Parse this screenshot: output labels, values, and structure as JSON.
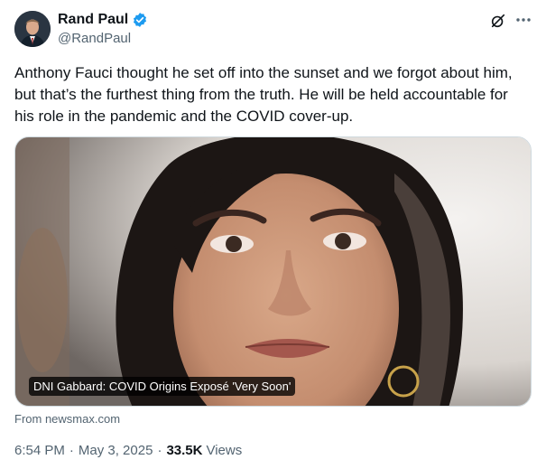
{
  "author": {
    "display_name": "Rand Paul",
    "handle": "@RandPaul",
    "verified": true
  },
  "tweet": {
    "text": "Anthony Fauci thought he set off into the sunset and we forgot about him, but that’s the furthest thing from the truth. He will be held accountable for his role in the pandemic and the COVID cover-up."
  },
  "media": {
    "caption": "DNI Gabbard: COVID Origins Exposé 'Very Soon'",
    "source": "From newsmax.com"
  },
  "meta": {
    "time": "6:54 PM",
    "separator": "·",
    "date": "May 3, 2025",
    "views_count": "33.5K",
    "views_label": "Views"
  },
  "icons": {
    "verified": "verified-badge-icon",
    "grok": "grok-icon",
    "more": "more-options-icon"
  },
  "colors": {
    "accent": "#1d9bf0",
    "text_primary": "#0f1419",
    "text_secondary": "#536471"
  }
}
